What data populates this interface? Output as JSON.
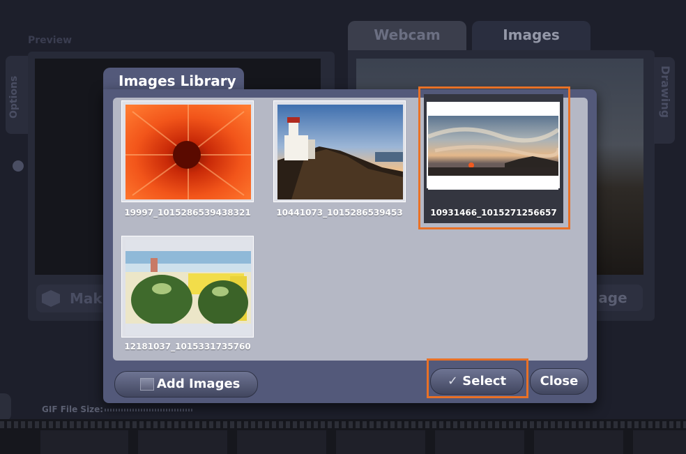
{
  "background": {
    "preview_label": "Preview",
    "make_button_label": "Mak",
    "options_tab_label": "Options",
    "tabs": [
      {
        "label": "Webcam"
      },
      {
        "label": "Images"
      }
    ],
    "drawing_tab_label": "Drawing",
    "image_button_label": "age",
    "gif_size_label": "GIF File Size:"
  },
  "dialog": {
    "title": "Images Library",
    "images": [
      {
        "name": "19997_1015286539438321",
        "icon": "flower-photo"
      },
      {
        "name": "10441073_1015286539453",
        "icon": "lighthouse-photo"
      },
      {
        "name": "10931466_1015271256657",
        "icon": "sunset-photo",
        "selected": true
      },
      {
        "name": "12181037_1015331735760",
        "icon": "coconuts-photo"
      }
    ],
    "buttons": {
      "add_images": "Add Images",
      "select": "Select",
      "close": "Close"
    }
  },
  "colors": {
    "highlight": "#e97126",
    "dialog_bg": "#53597a",
    "grid_bg": "#b5b8c5"
  }
}
